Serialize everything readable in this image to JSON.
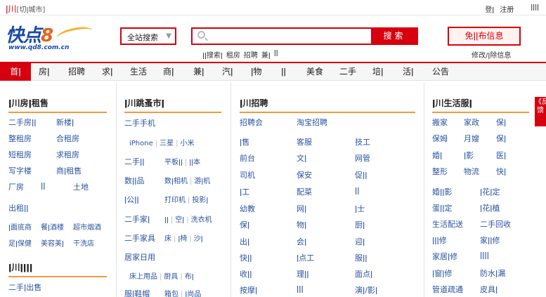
{
  "topbar": {
    "city": "ǀ川",
    "switch_city": "[切ǀ城市]",
    "login": "登ǀ",
    "register": "注册",
    "extra": "ǀǀǀǀ"
  },
  "header": {
    "logo_main_a": "快点",
    "logo_main_b": "8",
    "logo_url": "www.qd8.com.cn",
    "scope_label": "全站搜索",
    "search_placeholder": "",
    "search_button": "搜索",
    "hot_words": [
      "ǀǀ搜索ǀ",
      "租房",
      "招聘",
      "兼ǀ",
      "ǀǀ"
    ],
    "post_button": "免ǀǀ布信息",
    "manage_link": "修改/ǀ除信息"
  },
  "nav": {
    "items": [
      "首ǀ",
      "房ǀ",
      "招聘",
      "求ǀ",
      "生活",
      "商ǀ",
      "兼ǀ",
      "汽ǀ",
      "ǀ物",
      "ǀǀ",
      "美食",
      "二手",
      "培ǀ",
      "活ǀ",
      "公告"
    ]
  },
  "col1": {
    "title": "ǀ川房ǀ租售",
    "rows": [
      [
        "二手房ǀǀ",
        "新楼ǀ"
      ],
      [
        "整租房",
        "合租房"
      ],
      [
        "短租房",
        "求租房"
      ],
      [
        "写字楼",
        "商ǀ租售"
      ],
      [
        "厂房",
        "ǀǀ",
        "土地"
      ]
    ],
    "rent_out": "出租ǀǀ",
    "shop_links": [
      "ǀ面底商",
      "餐ǀ酒楼",
      "超市烟酒"
    ],
    "shop_links2": [
      "足ǀ保健",
      "美容美ǀ",
      "干洗店"
    ],
    "section2_title": "ǀ川ǀǀǀǀ",
    "section2_first": "二手ǀ出售"
  },
  "col2": {
    "title": "ǀ川跳蚤市ǀ",
    "rows": [
      {
        "main": "二手手机",
        "subs": []
      },
      {
        "main": "",
        "subs": [
          "iPhone",
          "三星",
          "小米"
        ]
      },
      {
        "main": "二手ǀǀ",
        "subs": [
          "平板ǀǀ",
          "ǀǀ本"
        ]
      },
      {
        "main": "数ǀǀ品",
        "subs": [
          "数ǀ相机",
          "游ǀ机"
        ]
      },
      {
        "main": "ǀ公ǀǀ",
        "subs": [
          "打印机",
          "投影ǀ"
        ]
      },
      {
        "main": "二手家ǀ",
        "subs": [
          "ǀǀ",
          "空ǀ",
          "洗衣机"
        ]
      },
      {
        "main": "二手家具",
        "subs": [
          "床",
          "ǀ椅",
          "沙ǀ"
        ]
      },
      {
        "main": "居家日用",
        "subs": []
      },
      {
        "main": "",
        "subs": [
          "床上用品",
          "厨具",
          "布ǀ"
        ]
      },
      {
        "main": "服ǀ鞋帽",
        "subs": [
          "箱包",
          "ǀ尚品"
        ]
      }
    ]
  },
  "col3": {
    "title": "ǀ川招聘",
    "rows": [
      [
        "招聘会",
        "淘宝招聘",
        ""
      ],
      [
        "ǀ售",
        "客服",
        "技工"
      ],
      [
        "前台",
        "文ǀ",
        "网管"
      ],
      [
        "司机",
        "保安",
        "促ǀǀ"
      ],
      [
        "ǀ工",
        "配菜",
        "ǀǀ"
      ],
      [
        "幼教",
        "网ǀ",
        "ǀ士"
      ],
      [
        "保ǀ",
        "物ǀ",
        "厨ǀ"
      ],
      [
        "出ǀ",
        "会ǀ",
        "迎ǀ"
      ],
      [
        "快ǀǀ",
        "ǀ点工",
        "服ǀǀ"
      ],
      [
        "收ǀǀ",
        "理ǀǀ",
        "面点ǀ"
      ],
      [
        "按摩ǀ",
        "ǀǀǀ",
        "演ǀ/影ǀ"
      ]
    ]
  },
  "col4": {
    "title": "ǀ川生活服ǀ",
    "rows": [
      [
        "搬家",
        "家政",
        "保ǀ"
      ],
      [
        "保姆",
        "月嫂",
        "保ǀ"
      ],
      [
        "婚ǀ",
        "ǀ影",
        "医ǀ"
      ],
      [
        "整形",
        "物流",
        "快ǀ"
      ],
      [
        "婚ǀǀ影",
        "ǀ花ǀ定"
      ],
      [
        "蛋ǀǀ定",
        "ǀ花ǀ植"
      ],
      [
        "生活配送",
        "二手回收"
      ],
      [
        "ǀǀǀ修",
        "家ǀǀ修"
      ],
      [
        "家居ǀ修",
        "ǀǀǀǀ"
      ],
      [
        "ǀ窗ǀ修",
        "防水ǀ漏"
      ],
      [
        "管道疏通",
        "皮具ǀ"
      ]
    ]
  },
  "feedback": "《反馈"
}
